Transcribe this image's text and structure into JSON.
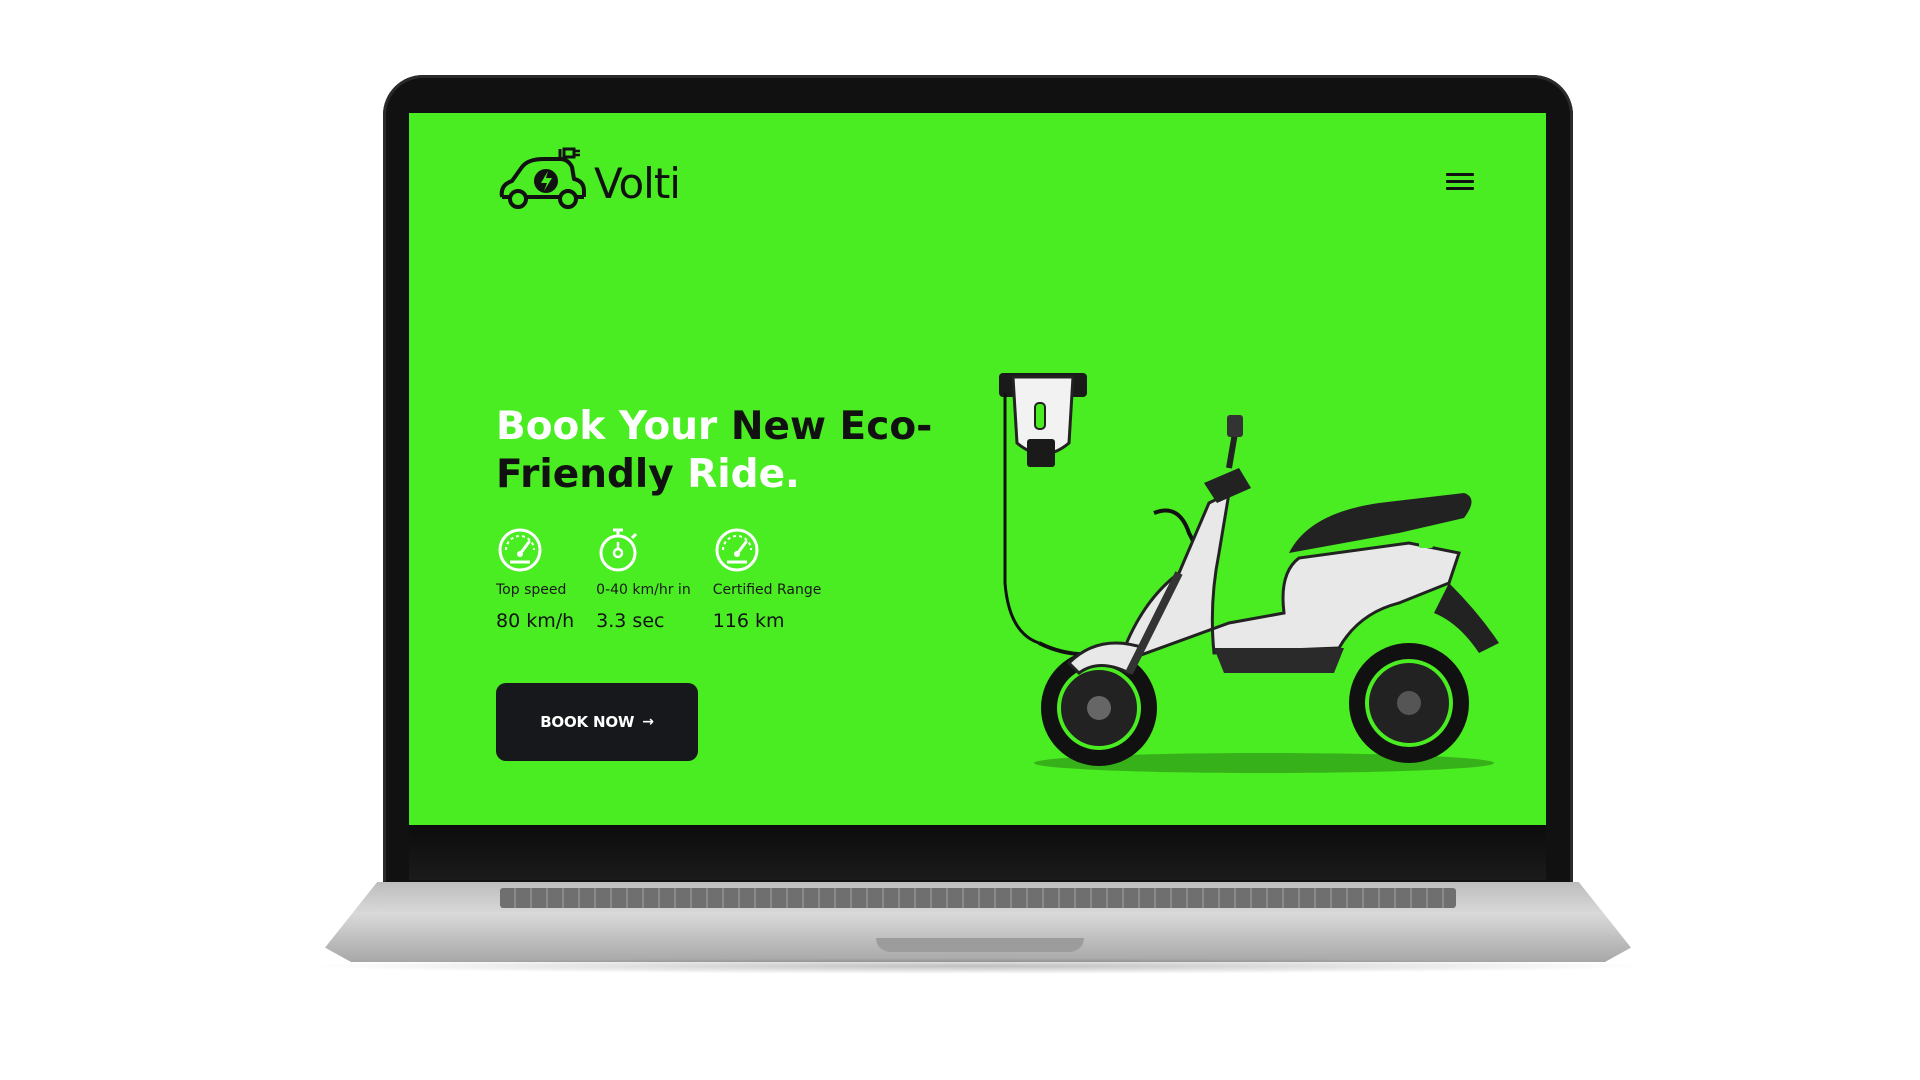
{
  "brand": {
    "name": "Volti"
  },
  "header": {
    "menu_icon": "hamburger-menu-icon"
  },
  "hero": {
    "title_white_1": "Book Your ",
    "title_dark_1": "New Eco-",
    "title_dark_2": "Friendly ",
    "title_white_2": "Ride."
  },
  "stats": [
    {
      "icon": "speedometer-icon",
      "label": "Top speed",
      "value": "80 km/h"
    },
    {
      "icon": "stopwatch-icon",
      "label": "0-40 km/hr in",
      "value": "3.3 sec"
    },
    {
      "icon": "speedometer-icon",
      "label": "Certified Range",
      "value": "116 km"
    }
  ],
  "cta": {
    "label": "BOOK NOW",
    "arrow": "→"
  },
  "colors": {
    "accent_green": "#4aec22",
    "button_dark": "#16181c",
    "text_dark": "#111111",
    "text_white": "#ffffff"
  }
}
